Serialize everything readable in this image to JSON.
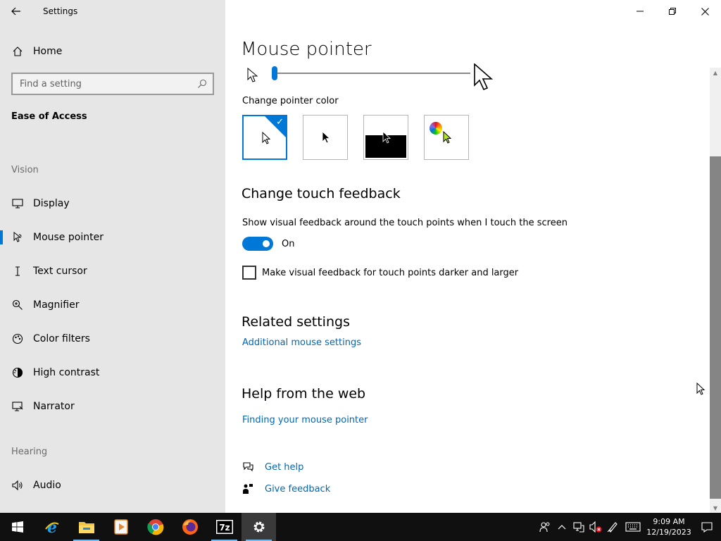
{
  "window": {
    "app_title": "Settings",
    "controls": [
      "minimize-icon",
      "restore-icon",
      "close-icon"
    ]
  },
  "sidebar": {
    "home_label": "Home",
    "search_placeholder": "Find a setting",
    "section_title": "Ease of Access",
    "groups": {
      "vision": "Vision",
      "hearing": "Hearing"
    },
    "items": [
      {
        "label": "Display",
        "icon": "monitor-icon"
      },
      {
        "label": "Mouse pointer",
        "icon": "mouse-pointer-icon",
        "selected": true
      },
      {
        "label": "Text cursor",
        "icon": "text-cursor-icon"
      },
      {
        "label": "Magnifier",
        "icon": "magnifier-icon"
      },
      {
        "label": "Color filters",
        "icon": "color-filters-icon"
      },
      {
        "label": "High contrast",
        "icon": "high-contrast-icon"
      },
      {
        "label": "Narrator",
        "icon": "narrator-icon"
      },
      {
        "label": "Audio",
        "icon": "audio-icon"
      }
    ],
    "accent": "#0078d7"
  },
  "main": {
    "title": "Mouse pointer",
    "pointer_size": {
      "value_fraction": 0.0
    },
    "pointer_color_label": "Change pointer color",
    "pointer_color_options": [
      {
        "name": "white",
        "selected": true
      },
      {
        "name": "black",
        "selected": false
      },
      {
        "name": "inverted",
        "selected": false
      },
      {
        "name": "custom",
        "selected": false,
        "custom_color": "#b4e61e"
      }
    ],
    "touch_heading": "Change touch feedback",
    "touch_toggle_label": "Show visual feedback around the touch points when I touch the screen",
    "touch_toggle_state": "On",
    "touch_toggle_on": true,
    "darker_checkbox_label": "Make visual feedback for touch points darker and larger",
    "darker_checkbox_checked": false,
    "related_heading": "Related settings",
    "related_link": "Additional mouse settings",
    "help_heading": "Help from the web",
    "help_link": "Finding your mouse pointer",
    "get_help": "Get help",
    "give_feedback": "Give feedback",
    "link_color": "#0067b8"
  },
  "taskbar": {
    "apps": [
      "start-icon",
      "internet-explorer-icon",
      "file-explorer-icon",
      "media-player-icon",
      "chrome-icon",
      "firefox-icon",
      "7zip-icon",
      "settings-icon"
    ],
    "time": "9:09 AM",
    "date": "12/19/2023"
  }
}
